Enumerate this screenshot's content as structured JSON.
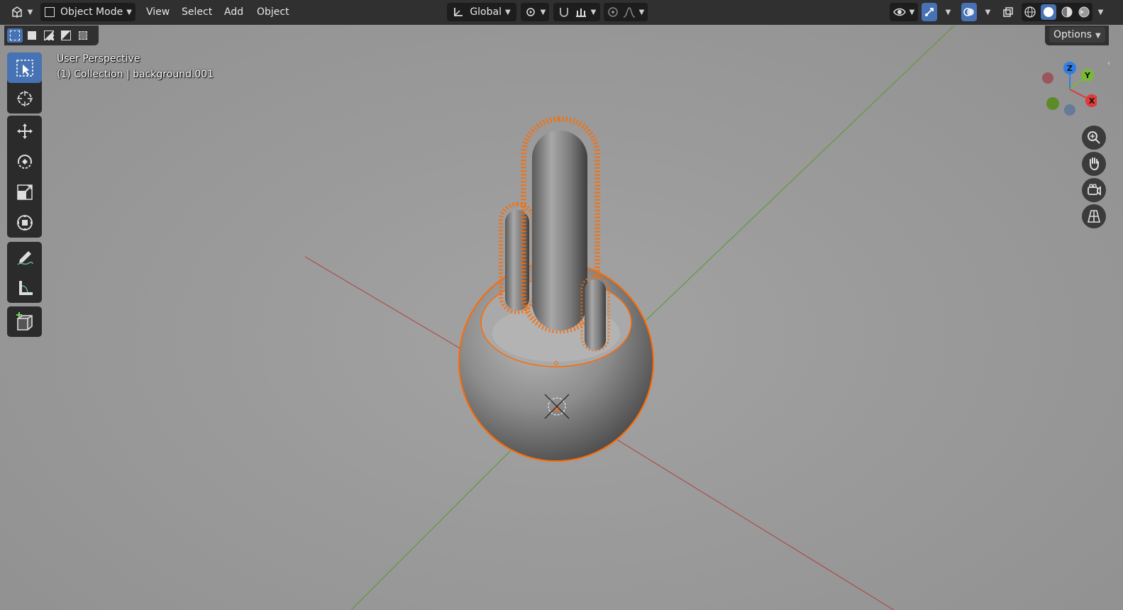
{
  "header": {
    "editor_type_icon": "3d-viewport-icon",
    "mode": "Object Mode",
    "menus": [
      "View",
      "Select",
      "Add",
      "Object"
    ],
    "transform_orientation": "Global",
    "right_icons": [
      "visibility-icon",
      "gizmo-icon",
      "overlay-icon",
      "xray-icon",
      "wireframe-shading-icon",
      "solid-shading-icon",
      "material-shading-icon",
      "rendered-shading-icon"
    ]
  },
  "viewport": {
    "perspective_label": "User Perspective",
    "collection_label": "(1) Collection | background.001",
    "options_label": "Options",
    "selection_color": "#ff6a00",
    "x_axis_color": "#b33a3a",
    "y_axis_color": "#5b9a2a",
    "gizmo": {
      "z": "Z",
      "y": "Y",
      "x": "X"
    }
  },
  "toolbar": {
    "tools": [
      "select-box-icon",
      "cursor-icon",
      "move-icon",
      "rotate-icon",
      "scale-icon",
      "transform-icon",
      "annotate-icon",
      "measure-icon",
      "add-cube-icon"
    ],
    "active": "select-box-icon"
  }
}
